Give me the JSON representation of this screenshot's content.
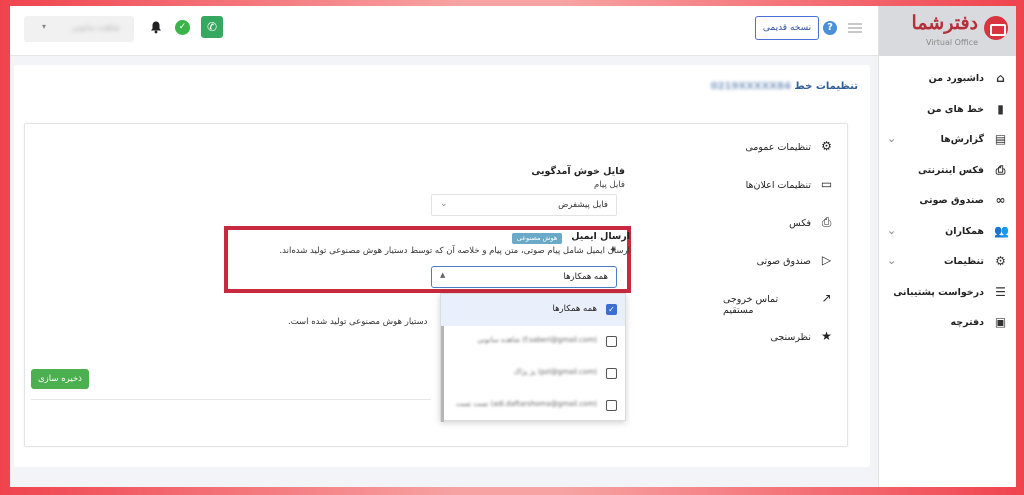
{
  "brand": {
    "title": "دفترشما",
    "subtitle": "Virtual Office"
  },
  "header": {
    "account_select": "شاهده سانونی",
    "old_version_label": "نسخه قدیمی",
    "help_symbol": "?",
    "verify_symbol": "✓",
    "phone_symbol": "✆",
    "chevron": "▾"
  },
  "sidebar": {
    "items": [
      {
        "label": "داشبورد من",
        "icon": "home-icon",
        "glyph": "⌂",
        "chevron": ""
      },
      {
        "label": "خط های من",
        "icon": "sim-card-icon",
        "glyph": "▮",
        "chevron": ""
      },
      {
        "label": "گزارش‌ها",
        "icon": "report-icon",
        "glyph": "▤",
        "chevron": "⌄"
      },
      {
        "label": "فکس اینترنتی",
        "icon": "fax-icon",
        "glyph": "⎙",
        "chevron": ""
      },
      {
        "label": "صندوق صوتی",
        "icon": "voicemail-icon",
        "glyph": "∞",
        "chevron": ""
      },
      {
        "label": "همکاران",
        "icon": "users-icon",
        "glyph": "👥",
        "chevron": "⌄"
      },
      {
        "label": "تنظیمات",
        "icon": "gear-icon",
        "glyph": "⚙",
        "chevron": "⌄"
      },
      {
        "label": "درخواست پشتیبانی",
        "icon": "support-icon",
        "glyph": "☰",
        "chevron": ""
      },
      {
        "label": "دفترچه",
        "icon": "contacts-icon",
        "glyph": "▣",
        "chevron": ""
      }
    ]
  },
  "page": {
    "title_prefix": "تنظیمات خط",
    "title_number": "0219XXXXX84"
  },
  "settings_menu": {
    "items": [
      {
        "label": "تنظیمات عمومی",
        "icon": "gear-icon",
        "glyph": "⚙"
      },
      {
        "label": "تنظیمات اعلان‌ها",
        "icon": "message-icon",
        "glyph": "▭"
      },
      {
        "label": "فکس",
        "icon": "fax-icon",
        "glyph": "⎙"
      },
      {
        "label": "صندوق صوتی",
        "icon": "play-icon",
        "glyph": "▷"
      },
      {
        "label": "تماس خروجی مستقیم",
        "icon": "outgoing-call-icon",
        "glyph": "↗"
      },
      {
        "label": "نظرسنجی",
        "icon": "star-icon",
        "glyph": "★"
      }
    ]
  },
  "welcome": {
    "title": "فایل خوش آمدگویی",
    "subtitle": "فایل پیام",
    "select_value": "فایل پیشفرض",
    "chevron": "⌄"
  },
  "email": {
    "title": "ارسال ایمیل",
    "ai_badge": "هوش مصنوعی",
    "description": "ارسال ایمیل شامل پیام صوتی، متن پیام و خلاصه آن که توسط دستیار هوش مصنوعی تولید شده‌اند.",
    "sparkle": "✦",
    "select_value": "همه همکارها",
    "caret": "▲"
  },
  "ai_note": "دستیار هوش مصنوعی تولید شده است.",
  "save_label": "ذخیره سازی",
  "dropdown": {
    "options": [
      {
        "label": "همه همکارها",
        "checked": "✓"
      },
      {
        "label": "شاهده سانونی (f.saberi@gmail.com)",
        "checked": ""
      },
      {
        "label": "پژ پژاک (pzi@gmail.com)",
        "checked": ""
      },
      {
        "label": "تست تست (adi.daftarshoma@gmail.com)",
        "checked": ""
      }
    ]
  }
}
